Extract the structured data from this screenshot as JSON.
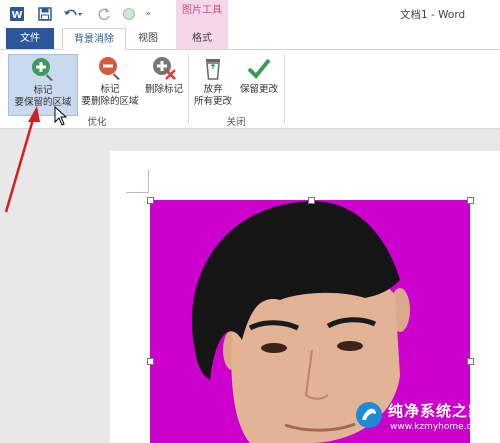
{
  "app": {
    "title": "文档1 - Word"
  },
  "qat": {
    "icons": [
      "word-logo-icon",
      "save-icon",
      "undo-icon",
      "redo-icon",
      "touch-mode-icon",
      "more-icon"
    ]
  },
  "context_tab_group": {
    "label": "图片工具"
  },
  "tabs": [
    {
      "label": "文件",
      "active": false,
      "style": "file"
    },
    {
      "label": "背景消除",
      "active": true
    },
    {
      "label": "视图",
      "active": false
    },
    {
      "label": "格式",
      "active": false
    }
  ],
  "ribbon": {
    "groups": [
      {
        "label": "优化",
        "commands": [
          {
            "line1": "标记",
            "line2": "要保留的区域",
            "icon": "mark-keep-icon"
          },
          {
            "line1": "标记",
            "line2": "要删除的区域",
            "icon": "mark-remove-icon"
          },
          {
            "line1": "删除标记",
            "line2": "",
            "icon": "delete-mark-icon"
          }
        ]
      },
      {
        "label": "关闭",
        "commands": [
          {
            "line1": "放弃",
            "line2": "所有更改",
            "icon": "discard-icon"
          },
          {
            "line1": "保留更改",
            "line2": "",
            "icon": "keep-changes-icon"
          }
        ]
      }
    ]
  },
  "colors": {
    "accent": "#2b579a",
    "context": "#c0508c",
    "background_removal": "#cc00cc",
    "arrow": "#d01f1f"
  },
  "watermark": {
    "brand": "纯净系统之家",
    "url": "www.kzmyhome.com"
  }
}
